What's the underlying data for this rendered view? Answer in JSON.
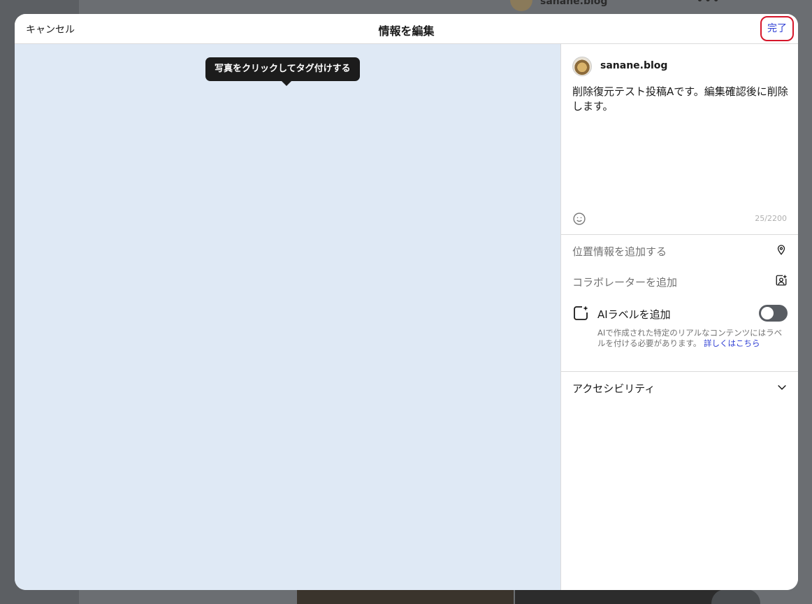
{
  "background": {
    "post_username": "sanane.blog",
    "more_icon": "more-horizontal-icon"
  },
  "modal": {
    "cancel_label": "キャンセル",
    "title": "情報を編集",
    "done_label": "完了",
    "accent_color": "#2f3fd4",
    "highlight_color": "#d6162a"
  },
  "photo": {
    "tag_tooltip": "写真をクリックしてタグ付けする",
    "background_color": "#dfe9f5"
  },
  "sidebar": {
    "username": "sanane.blog",
    "caption": "削除復元テスト投稿Aです。編集確認後に削除します。",
    "emoji_icon": "smiley-icon",
    "char_count": "25/2200",
    "location_label": "位置情報を追加する",
    "location_icon": "map-pin-icon",
    "collaborator_label": "コラボレーターを追加",
    "collaborator_icon": "add-person-icon",
    "ai_label": {
      "label": "AIラベルを追加",
      "icon": "sparkle-square-icon",
      "toggle_on": false,
      "help_text": "AIで作成された特定のリアルなコンテンツにはラベルを付ける必要があります。",
      "learn_more": "詳しくはこちら"
    },
    "accessibility_label": "アクセシビリティ",
    "accessibility_icon": "chevron-down-icon"
  }
}
